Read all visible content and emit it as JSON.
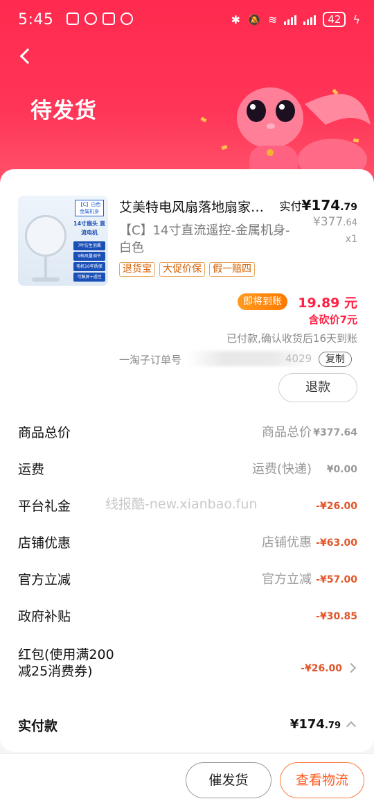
{
  "status_bar": {
    "time": "5:45",
    "battery": "42"
  },
  "header": {
    "title": "待发货"
  },
  "product": {
    "title": "艾美特电风扇落地扇家…",
    "sku": "【C】14寸直流遥控-金属机身-白色",
    "thumbnail_texts": {
      "top": "【C】白色 金属机身",
      "big": "14寸扇头 直流电机",
      "line1": "7叶仿生羽翼",
      "line2": "9档风量调节",
      "line3": "电机10年质保",
      "line4": "可触屏+遥控"
    },
    "tags": [
      "退货宝",
      "大促价保",
      "假一赔四"
    ],
    "paid_label": "实付",
    "paid_int": "¥174",
    "paid_dec": ".79",
    "orig_int": "¥377",
    "orig_dec": ".64",
    "qty": "x1"
  },
  "arrival": {
    "badge": "即将到账",
    "amount": "19.89 元",
    "bargain": "含砍价7元",
    "note": "已付款,确认收货后16天到账"
  },
  "suborder": {
    "label": "淘子订单号",
    "visible_tail": "4029",
    "copy": "复制"
  },
  "refund_button": "退款",
  "price_rows": [
    {
      "label": "商品总价",
      "mid": "商品总价",
      "amount": "¥377.64",
      "red": false
    },
    {
      "label": "运费",
      "mid": "运费(快递)",
      "amount": "¥0.00",
      "red": false
    },
    {
      "label": "平台礼金",
      "mid": "",
      "amount": "-¥26.00",
      "red": true
    },
    {
      "label": "店铺优惠",
      "mid": "店铺优惠",
      "amount": "-¥63.00",
      "red": true
    },
    {
      "label": "官方立减",
      "mid": "官方立减",
      "amount": "-¥57.00",
      "red": true
    },
    {
      "label": "政府补贴",
      "mid": "",
      "amount": "-¥30.85",
      "red": true
    }
  ],
  "hongbao": {
    "label": "红包(使用满200减25消费券)",
    "amount": "-¥26.00"
  },
  "watermark": "线报酷-new.xianbao.fun",
  "total": {
    "label": "实付款",
    "amount_int": "¥174",
    "amount_dec": ".79"
  },
  "bottom": {
    "urge": "催发货",
    "logistics": "查看物流"
  },
  "colors": {
    "header": "#ff2a4f",
    "accent_red": "#ff2244",
    "discount": "#e0562a",
    "badge_orange": "#ff8a10"
  }
}
